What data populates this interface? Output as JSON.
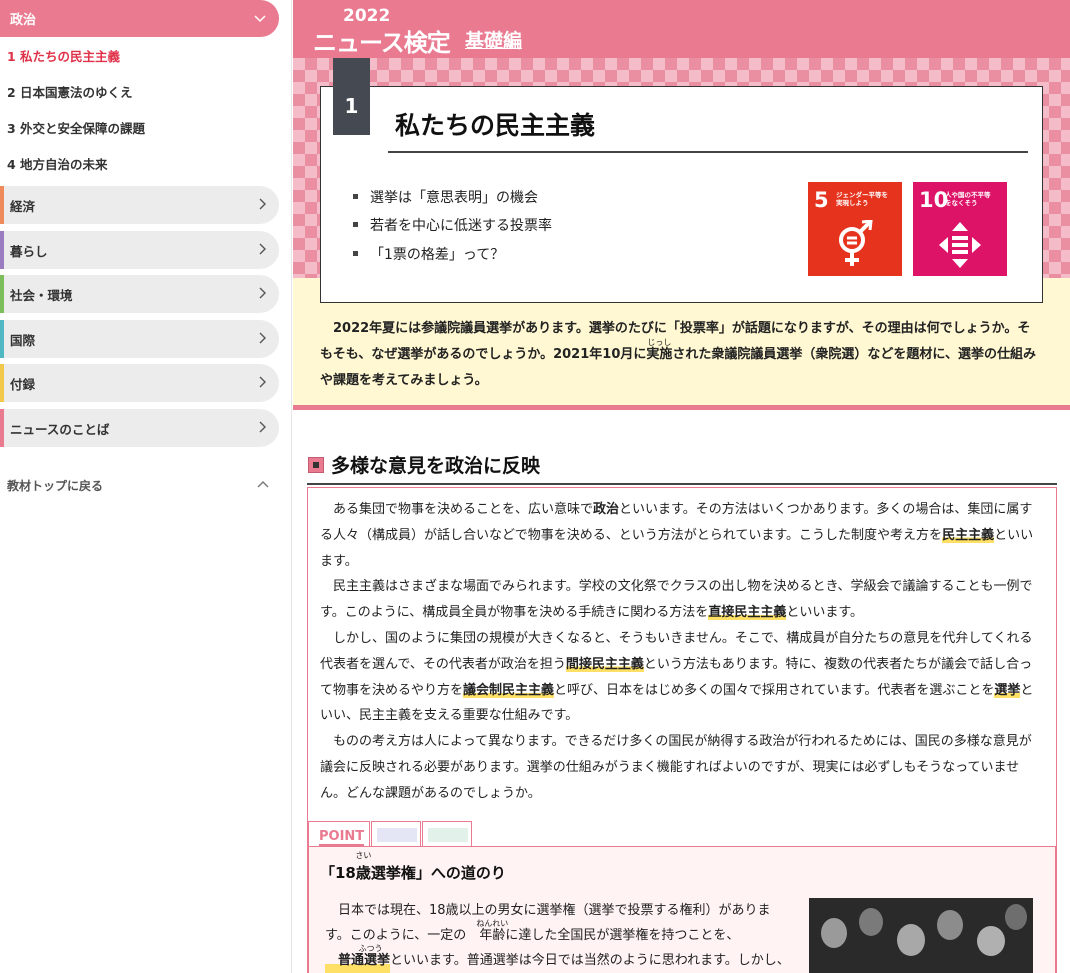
{
  "sidebar": {
    "active_category": "政治",
    "sub_items": [
      "1 私たちの民主主義",
      "2 日本国憲法のゆくえ",
      "3 外交と安全保障の課題",
      "4 地方自治の未来"
    ],
    "categories": [
      {
        "label": "経済",
        "color": "#ef8a5a"
      },
      {
        "label": "暮らし",
        "color": "#9a7cc0"
      },
      {
        "label": "社会・環境",
        "color": "#7cbf5a"
      },
      {
        "label": "国際",
        "color": "#4fb8c4"
      },
      {
        "label": "付録",
        "color": "#f2c84a"
      },
      {
        "label": "ニュースのことば",
        "color": "#e97a90"
      }
    ],
    "back_link": "教材トップに戻る"
  },
  "header": {
    "year": "2022",
    "name": "ニュース検定",
    "edition": "基礎編"
  },
  "chapter": {
    "number": "1",
    "title": "私たちの民主主義",
    "bullets": [
      "選挙は「意思表明」の機会",
      "若者を中心に低迷する投票率",
      "「1票の格差」って？"
    ],
    "sdgs": [
      {
        "number": "5",
        "caption_1": "ジェンダー平等を",
        "caption_2": "実現しよう",
        "color": "#e6331e"
      },
      {
        "number": "10",
        "caption_1": "人や国の不平等",
        "caption_2": "をなくそう",
        "color": "#dd1367"
      }
    ]
  },
  "intro": {
    "part1": "2022年夏には参議院議員選挙があります。選挙のたびに「投票率」が話題になりますが、その理由は何でしょうか。そもそも、なぜ選挙があるのでしょうか。2021年10月に",
    "ruby_base": "実施",
    "ruby_text": "じっし",
    "part2": "された衆議院議員選挙（衆院選）などを題材に、選挙の仕組みや課題を考えてみましょう。"
  },
  "section": {
    "title": "多様な意見を政治に反映",
    "p1": {
      "a": "ある集団で物事を決めることを、広い意味で",
      "b1": "政治",
      "c": "といいます。その方法はいくつかあります。多くの場合は、集団に属する人々（構成員）が話し合いなどで物事を決める、という方法がとられています。こうした制度や考え方を",
      "k1": "民主主義",
      "d": "といいます。"
    },
    "p2": {
      "a": "民主主義はさまざまな場面でみられます。学校の文化祭でクラスの出し物を決めるとき、学級会で議論することも一例です。このように、構成員全員が物事を決める手続きに関わる方法を",
      "k1": "直接民主主義",
      "b": "といいます。"
    },
    "p3": {
      "a": "しかし、国のように集団の規模が大きくなると、そうもいきません。そこで、構成員が自分たちの意見を代弁してくれる代表者を選んで、その代表者が政治を担う",
      "k1": "間接民主主義",
      "b": "という方法もあります。特に、複数の代表者たちが議会で話し合って物事を決めるやり方を",
      "k2": "議会制民主主義",
      "c": "と呼び、日本をはじめ多くの国々で採用されています。代表者を選ぶことを",
      "k3": "選挙",
      "d": "といい、民主主義を支える重要な仕組みです。"
    },
    "p4": "ものの考え方は人によって異なります。できるだけ多くの国民が納得する政治が行われるためには、国民の多様な意見が議会に反映される必要があります。選挙の仕組みがうまく機能すればよいのですが、現実には必ずしもそうなっていません。どんな課題があるのでしょうか。"
  },
  "point": {
    "tab_label": "POINT",
    "title_pre": "「18",
    "title_ruby_base": "歳",
    "title_ruby_text": "さい",
    "title_post": "選挙権」への道のり",
    "text_a": "日本では現在、18歳以上の男女に選挙権（選挙で投票する権利）があります。このように、一定の",
    "ruby1_base": "年齢",
    "ruby1_text": "ねんれい",
    "text_b": "に達した全国民が選挙権を持つことを、",
    "kw_base": "普通選挙",
    "kw_ruby": "ふつう",
    "text_c": "といいます。普通選挙は今日では当然のように思われます。しかし、日本"
  }
}
